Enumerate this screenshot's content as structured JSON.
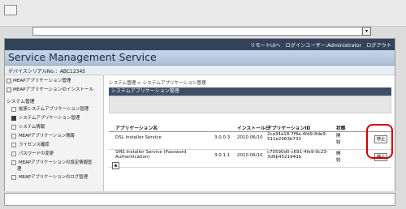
{
  "header": {
    "link_remote_ui": "リモートUIへ",
    "login_user": "ログインユーザー:Administrator",
    "logout": "ログアウト",
    "app_title": "Service Management Service",
    "device_serial": "デバイスシリアルNo.：ABC12345"
  },
  "sidebar": {
    "items": [
      {
        "label": "MEAPアプリケーション管理"
      },
      {
        "label": "MEAPアプリケーションのインストール"
      }
    ],
    "section": "システム管理",
    "subitems": [
      {
        "label": "拡張システムアプリケーション管理"
      },
      {
        "label": "システムアプリケーション管理"
      },
      {
        "label": "システム情報"
      },
      {
        "label": "MEAPアプリケーション情報"
      },
      {
        "label": "ライセンス確認"
      },
      {
        "label": "パスワードの変更"
      },
      {
        "label": "MEAPアプリケーションの設定情報管"
      },
      {
        "label": "理"
      },
      {
        "label": "MEAPアプリケーションのログ管理"
      }
    ]
  },
  "content": {
    "breadcrumb": "システム管理 > システムアプリケーション管理",
    "panel_title": "システムアプリケーション管理",
    "table": {
      "headers": [
        "アプリケーション名",
        "",
        "インストール日",
        "アプリケーションID",
        "状態"
      ],
      "rows": [
        {
          "name": "DSL Installer Service",
          "version": "3.0.0.3",
          "date": "2010 06/10",
          "id": "2ca34a18-7f8a-4fd9-8de9-511e2963b733",
          "status": "開始",
          "action": "停止"
        },
        {
          "name": "SMS Installer Service (Password Authentication)",
          "version": "3.0.1.1",
          "date": "2010 06/10",
          "id": "c70590d0-c691-4fe9-9c23-3d9b452194db",
          "status": "開始",
          "action": "停止"
        }
      ]
    }
  },
  "colors": {
    "accent": "#31445c",
    "highlight": "#d00000"
  }
}
